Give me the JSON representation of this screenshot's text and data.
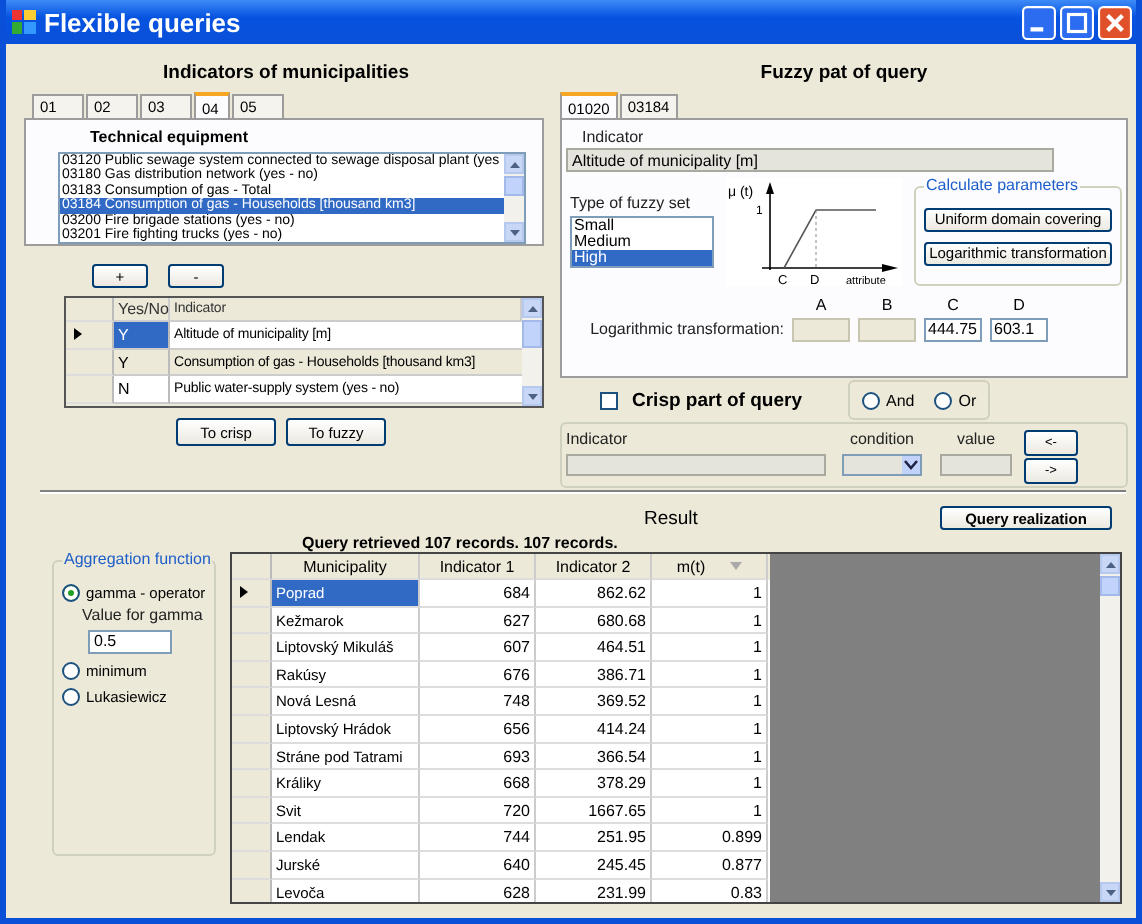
{
  "window": {
    "title": "Flexible queries"
  },
  "indicators": {
    "title": "Indicators of municipalities",
    "tabs": [
      {
        "label": "01",
        "selected": false
      },
      {
        "label": "02",
        "selected": false
      },
      {
        "label": "03",
        "selected": false
      },
      {
        "label": "04",
        "selected": true
      },
      {
        "label": "05",
        "selected": false
      }
    ],
    "group_title": "Technical equipment",
    "items": [
      {
        "text": "03120  Public sewage system connected to sewage disposal plant (yes",
        "selected": false
      },
      {
        "text": "03180  Gas distribution network (yes - no)",
        "selected": false
      },
      {
        "text": "03183  Consumption of gas - Total",
        "selected": false
      },
      {
        "text": "03184  Consumption of gas - Households [thousand km3]",
        "selected": true
      },
      {
        "text": "03200  Fire brigade stations (yes - no)",
        "selected": false
      },
      {
        "text": "03201  Fire fighting trucks (yes - no)",
        "selected": false
      }
    ],
    "add_button": "+",
    "remove_button": "-",
    "grid": {
      "columns": [
        "Yes/No",
        "Indicator"
      ],
      "rows": [
        {
          "current": true,
          "selected": true,
          "value": "Y",
          "indicator": "Altitude of municipality [m]"
        },
        {
          "current": false,
          "selected": false,
          "value": "Y",
          "indicator": "Consumption of gas - Households [thousand km3]"
        },
        {
          "current": false,
          "selected": false,
          "value": "N",
          "indicator": "Public water-supply system (yes - no)"
        }
      ]
    },
    "buttons": [
      "To crisp",
      "To fuzzy"
    ]
  },
  "fuzzy": {
    "title": "Fuzzy pat of query",
    "tabs": [
      {
        "label": "01020",
        "selected": true
      },
      {
        "label": "03184",
        "selected": false
      }
    ],
    "indicator_label": "Indicator",
    "indicator_value": "Altitude of municipality [m]",
    "set_type_label": "Type of fuzzy set",
    "set_types": [
      {
        "label": "Small",
        "selected": false
      },
      {
        "label": "Medium",
        "selected": false
      },
      {
        "label": "High",
        "selected": true
      }
    ],
    "graph": {
      "y_label": "μ (t)",
      "y_tick": "1",
      "x_points": [
        "C",
        "D"
      ],
      "x_label": "attribute"
    },
    "calc_title": "Calculate parameters",
    "calc_buttons": [
      "Uniform domain covering",
      "Logarithmic transformation"
    ],
    "params_label": "Logarithmic transformation:",
    "params": [
      {
        "name": "A"
      },
      {
        "name": "B"
      },
      {
        "name": "C",
        "value": "444.75"
      },
      {
        "name": "D",
        "value": "603.1"
      }
    ]
  },
  "crisp": {
    "checked": false,
    "title": "Crisp part of query",
    "operators": [
      {
        "label": "And",
        "selected": false
      },
      {
        "label": "Or",
        "selected": false
      }
    ],
    "indicator_label": "Indicator",
    "condition_label": "condition",
    "value_label": "value",
    "buttons": [
      "<-",
      "->"
    ]
  },
  "result": {
    "title": "Result",
    "button": "Query realization",
    "status": "Query retrieved 107 records. 107 records.",
    "aggregation": {
      "title": "Aggregation function",
      "options": [
        {
          "label": "gamma - operator",
          "selected": true
        },
        {
          "label": "minimum",
          "selected": false
        },
        {
          "label": "Lukasiewicz",
          "selected": false
        }
      ],
      "gamma_label": "Value for gamma",
      "gamma_value": "0.5"
    },
    "table": {
      "columns": [
        "Municipality",
        "Indicator 1",
        "Indicator 2",
        "m(t)"
      ],
      "rows": [
        {
          "current": true,
          "selected": true,
          "cells": [
            "Poprad",
            "684",
            "862.62",
            "1"
          ]
        },
        {
          "current": false,
          "selected": false,
          "cells": [
            "Kežmarok",
            "627",
            "680.68",
            "1"
          ]
        },
        {
          "current": false,
          "selected": false,
          "cells": [
            "Liptovský Mikuláš",
            "607",
            "464.51",
            "1"
          ]
        },
        {
          "current": false,
          "selected": false,
          "cells": [
            "Rakúsy",
            "676",
            "386.71",
            "1"
          ]
        },
        {
          "current": false,
          "selected": false,
          "cells": [
            "Nová Lesná",
            "748",
            "369.52",
            "1"
          ]
        },
        {
          "current": false,
          "selected": false,
          "cells": [
            "Liptovský Hrádok",
            "656",
            "414.24",
            "1"
          ]
        },
        {
          "current": false,
          "selected": false,
          "cells": [
            "Stráne pod Tatrami",
            "693",
            "366.54",
            "1"
          ]
        },
        {
          "current": false,
          "selected": false,
          "cells": [
            "Králiky",
            "668",
            "378.29",
            "1"
          ]
        },
        {
          "current": false,
          "selected": false,
          "cells": [
            "Svit",
            "720",
            "1667.65",
            "1"
          ]
        },
        {
          "current": false,
          "selected": false,
          "cells": [
            "Lendak",
            "744",
            "251.95",
            "0.899"
          ]
        },
        {
          "current": false,
          "selected": false,
          "cells": [
            "Jurské",
            "640",
            "245.45",
            "0.877"
          ]
        },
        {
          "current": false,
          "selected": false,
          "cells": [
            "Levoča",
            "628",
            "231.99",
            "0.83"
          ]
        }
      ]
    }
  }
}
